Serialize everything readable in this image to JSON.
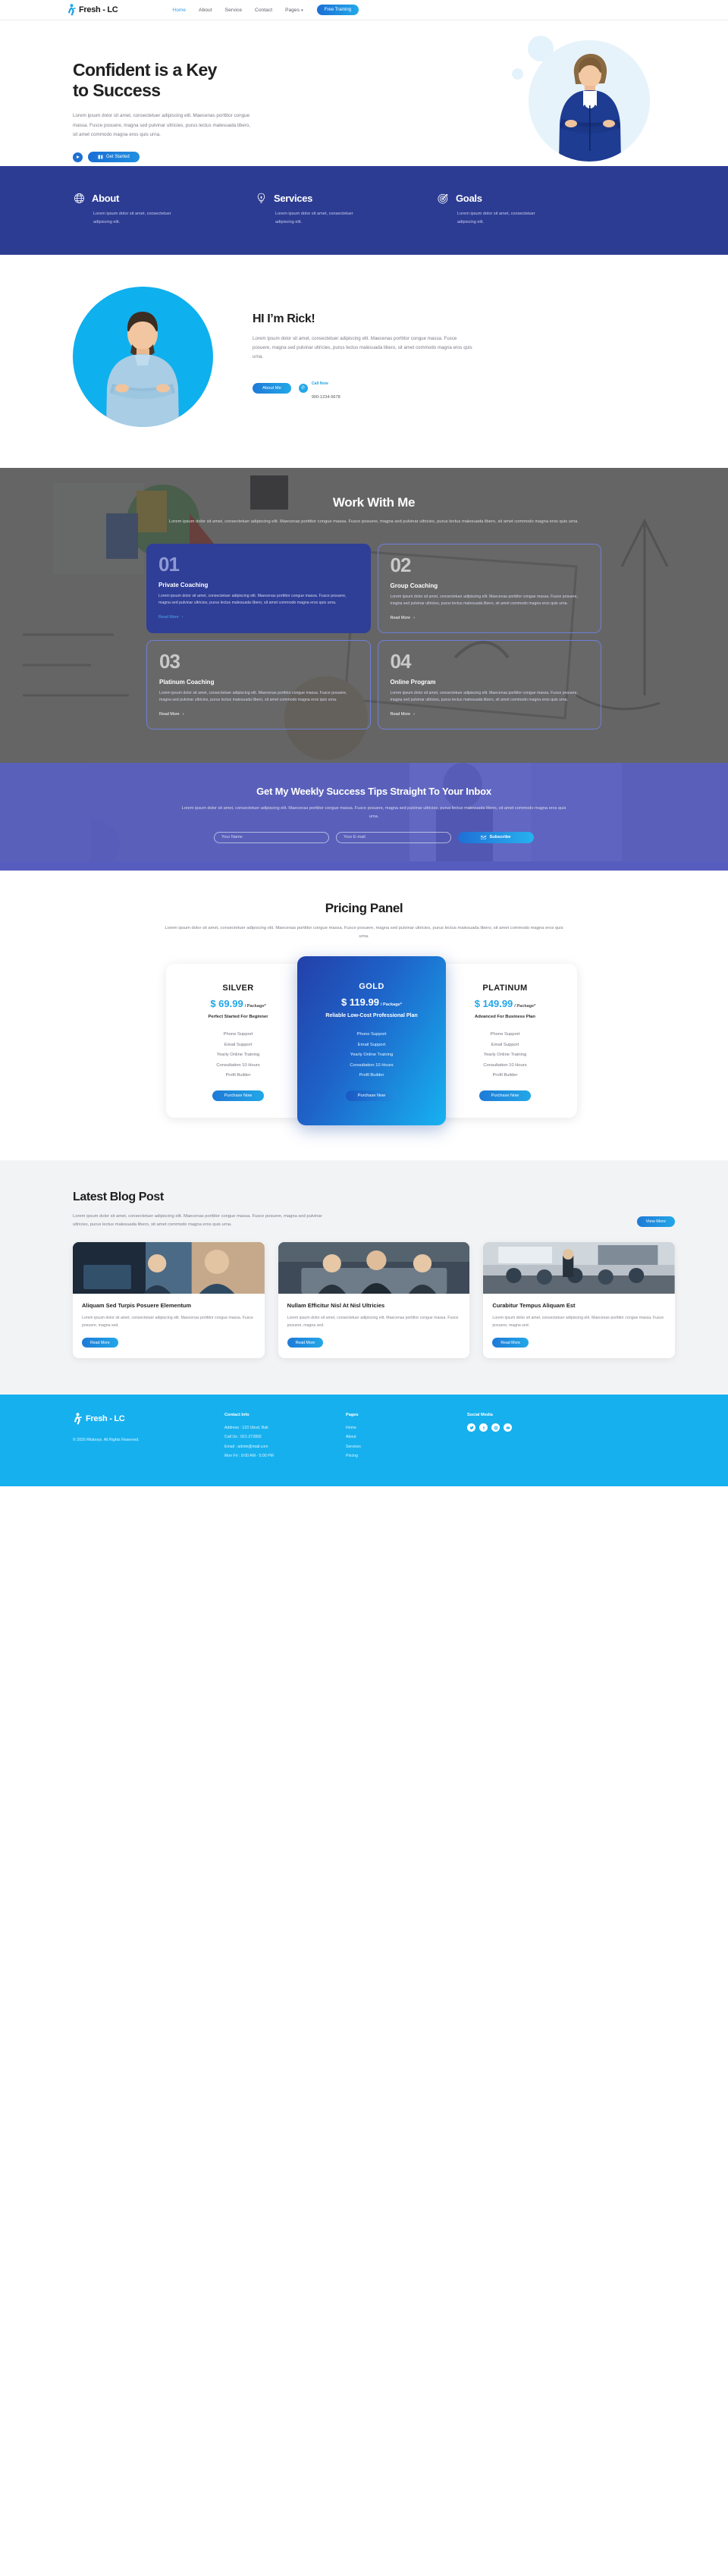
{
  "nav": {
    "brand": "Fresh - LC",
    "links": [
      {
        "label": "Home",
        "active": true
      },
      {
        "label": "About",
        "active": false
      },
      {
        "label": "Service",
        "active": false
      },
      {
        "label": "Contact",
        "active": false
      },
      {
        "label": "Pages",
        "active": false,
        "caret": "▾"
      }
    ],
    "cta": "Free Training"
  },
  "hero": {
    "title_line1": "Confident is a Key",
    "title_line2": "to Success",
    "paragraph": "Lorem ipsum dolor sit amet, consectetuer adipiscing elit. Maecenas porttitor congue massa. Fusce posuere, magna sed pulvinar ultricies, purus lectus malesuada libero, sit amet commodo magna eros quis urna.",
    "cta": "Get Started",
    "play_icon": "play-icon"
  },
  "features": [
    {
      "icon": "globe-icon",
      "title": "About",
      "text": "Lorem ipsum dolor sit amet, consectetuer adipiscing elit."
    },
    {
      "icon": "lightbulb-icon",
      "title": "Services",
      "text": "Lorem ipsum dolor sit amet, consectetuer adipiscing elit."
    },
    {
      "icon": "target-icon",
      "title": "Goals",
      "text": "Lorem ipsum dolor sit amet, consectetuer adipiscing elit."
    }
  ],
  "about": {
    "title": "HI I’m Rick!",
    "paragraph": "Lorem ipsum dolor sit amet, consectetuer adipiscing elit. Maecenas porttitor congue massa. Fusce posuere, magna sed pulvinar ultricies, purus lectus malesuada libero, sit amet commodo magna eros quis urna.",
    "button": "About Me",
    "call_label": "Call Now",
    "call_number": "900-1234-5678"
  },
  "work": {
    "title": "Work With Me",
    "subtitle": "Lorem ipsum dolor sit amet, consectetuer adipiscing elit. Maecenas porttitor congue massa. Fusce posuere, magna sed pulvinar ultricies, purus lectus malesuada libero, sit amet commodo magna eros quis urna.",
    "cards": [
      {
        "num": "01",
        "title": "Private Coaching",
        "text": "Lorem ipsum dolor sit amet, consectetuer adipiscing elit. Maecenas porttitor congue massa. Fusce posuere, magna sed pulvinar ultricies, purus lectus malesuada libero, sit amet commodo magna eros quis urna.",
        "link": "Read More"
      },
      {
        "num": "02",
        "title": "Group Coaching",
        "text": "Lorem ipsum dolor sit amet, consectetuer adipiscing elit. Maecenas porttitor congue massa. Fusce posuere, magna sed pulvinar ultricies, purus lectus malesuada libero, sit amet commodo magna eros quis urna.",
        "link": "Read More"
      },
      {
        "num": "03",
        "title": "Platinum Coaching",
        "text": "Lorem ipsum dolor sit amet, consectetuer adipiscing elit. Maecenas porttitor congue massa. Fusce posuere, magna sed pulvinar ultricies, purus lectus malesuada libero, sit amet commodo magna eros quis urna.",
        "link": "Read More"
      },
      {
        "num": "04",
        "title": "Online Program",
        "text": "Lorem ipsum dolor sit amet, consectetuer adipiscing elit. Maecenas porttitor congue massa. Fusce posuere, magna sed pulvinar ultricies, purus lectus malesuada libero, sit amet commodo magna eros quis urna.",
        "link": "Read More"
      }
    ]
  },
  "newsletter": {
    "title": "Get My Weekly Success Tips Straight To Your Inbox",
    "subtitle": "Lorem ipsum dolor sit amet, consectetuer adipiscing elit. Maecenas porttitor congue massa. Fusce posuere, magna sed pulvinar ultricies, purus lectus malesuada libero, sit amet commodo magna eros quis urna.",
    "name_placeholder": "Your Name",
    "email_placeholder": "Your E-mail",
    "button": "Subscribe"
  },
  "pricing": {
    "title": "Pricing Panel",
    "subtitle": "Lorem ipsum dolor sit amet, consectetuer adipiscing elit. Maecenas porttitor congue massa. Fusce posuere, magna sed pulvinar ultricies, purus lectus malesuada libero, sit amet commodo magna eros quis urna.",
    "per": "/ Package*",
    "plans": [
      {
        "name": "SILVER",
        "price": "$ 69.99",
        "tagline": "Perfect Started For Beginner",
        "features": [
          "Phone Support",
          "Email Support",
          "Yearly Online Training",
          "Consultation 10 Hours",
          "Profil Builder"
        ],
        "button": "Purchase Now"
      },
      {
        "name": "GOLD",
        "price": "$ 119.99",
        "tagline": "Reliable Low-Cost Professional Plan",
        "features": [
          "Phone Support",
          "Email Support",
          "Yearly Online Training",
          "Consultation 10 Hours",
          "Profil Builder"
        ],
        "button": "Purchase Now"
      },
      {
        "name": "PLATINUM",
        "price": "$ 149.99",
        "tagline": "Advanced For Business Plan",
        "features": [
          "Phone Support",
          "Email Support",
          "Yearly Online Training",
          "Consultation 10 Hours",
          "Profil Builder"
        ],
        "button": "Purchase Now"
      }
    ]
  },
  "blog": {
    "title": "Latest Blog Post",
    "subtitle": "Lorem ipsum dolor sit amet, consectetuer adipiscing elit. Maecenas porttitor congue massa. Fusce posuere, magna sed pulvinar ultricies, purus lectus malesuada libero, sit amet commodo magna eros quis urna.",
    "view_more": "View More",
    "posts": [
      {
        "title": "Aliquam Sed Turpis Posuere Elementum",
        "text": "Lorem ipsum dolor sit amet, consectetuer adipiscing elit. Maecenas porttitor congue massa. Fusce posuere, magna sed.",
        "button": "Read More"
      },
      {
        "title": "Nullam Efficitur Nisl At Nisl Ultricies",
        "text": "Lorem ipsum dolor sit amet, consectetuer adipiscing elit. Maecenas porttitor congue massa. Fusce posuere, magna sed.",
        "button": "Read More"
      },
      {
        "title": "Curabitur Tempus Aliquam Est",
        "text": "Lorem ipsum dolor sit amet, consectetuer adipiscing elit. Maecenas porttitor congue massa. Fusce posuere, magna sed.",
        "button": "Read More"
      }
    ]
  },
  "footer": {
    "brand": "Fresh - LC",
    "copyright": "© 2020 Ritsboys. All Rights Reserved.",
    "contact_head": "Contact Info",
    "contact": [
      "Address : 123 Ubud, Bali.",
      "Call Us : 021-272892",
      "Email : admin@mail.com",
      "Mon Fri : 9:00 AM - 5:00 PM"
    ],
    "pages_head": "Pages",
    "pages": [
      "Home",
      "About",
      "Services",
      "Pricing"
    ],
    "social_head": "Social Media",
    "socials": [
      "twitter-icon",
      "facebook-icon",
      "instagram-icon",
      "youtube-icon"
    ]
  },
  "colors": {
    "brand_blue": "#16b0ee",
    "navy": "#2d3c93",
    "accent": "#22a7e8"
  }
}
